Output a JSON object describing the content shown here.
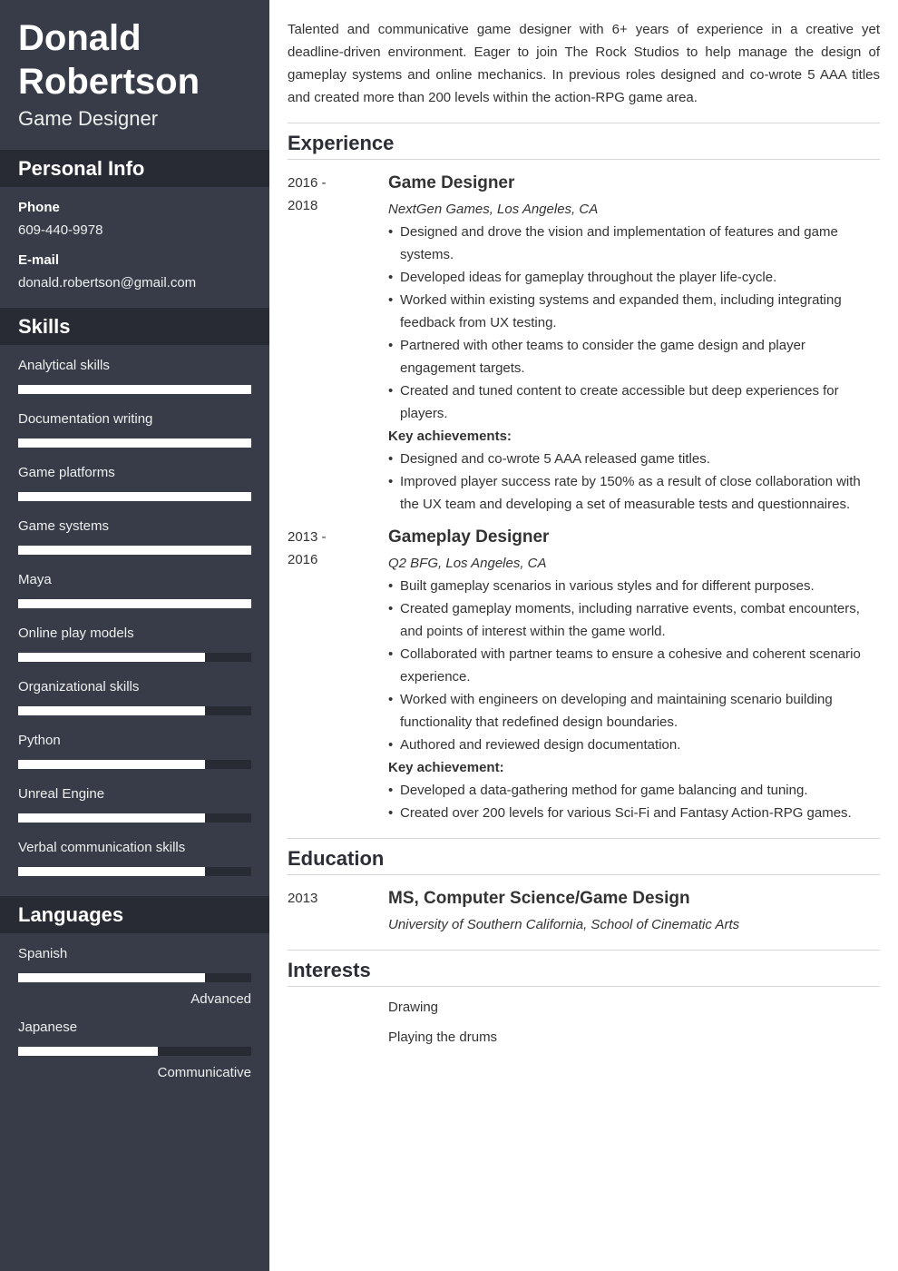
{
  "header": {
    "name_line1": "Donald",
    "name_line2": "Robertson",
    "title": "Game Designer"
  },
  "personal_info": {
    "heading": "Personal Info",
    "phone_label": "Phone",
    "phone": "609-440-9978",
    "email_label": "E-mail",
    "email": "donald.robertson@gmail.com"
  },
  "skills": {
    "heading": "Skills",
    "items": [
      {
        "label": "Analytical skills",
        "level": 1.0
      },
      {
        "label": "Documentation writing",
        "level": 1.0
      },
      {
        "label": "Game platforms",
        "level": 1.0
      },
      {
        "label": "Game systems",
        "level": 1.0
      },
      {
        "label": "Maya",
        "level": 1.0
      },
      {
        "label": "Online play models",
        "level": 0.8
      },
      {
        "label": "Organizational skills",
        "level": 0.8
      },
      {
        "label": "Python",
        "level": 0.8
      },
      {
        "label": "Unreal Engine",
        "level": 0.8
      },
      {
        "label": "Verbal communication skills",
        "level": 0.8
      }
    ]
  },
  "languages": {
    "heading": "Languages",
    "items": [
      {
        "label": "Spanish",
        "level": 0.8,
        "level_label": "Advanced"
      },
      {
        "label": "Japanese",
        "level": 0.6,
        "level_label": "Communicative"
      }
    ]
  },
  "summary": "Talented and communicative game designer with 6+ years of experience in a creative yet deadline-driven environment. Eager to join The Rock Studios to help manage the design of gameplay systems and online mechanics. In previous roles designed and co-wrote 5 AAA titles and created more than 200 levels within the action-RPG game area.",
  "experience": {
    "heading": "Experience",
    "entries": [
      {
        "date_start": "2016 -",
        "date_end": "2018",
        "title": "Game Designer",
        "company": "NextGen Games, Los Angeles, CA",
        "bullets": [
          "Designed and drove the vision and implementation of features and game systems.",
          "Developed ideas for gameplay throughout the player life-cycle.",
          "Worked within existing systems and expanded them, including integrating feedback from UX testing.",
          "Partnered with other teams to consider the game design and player engagement targets.",
          "Created and tuned content to create accessible but deep experiences for players."
        ],
        "achievements_label": "Key achievements:",
        "achievements": [
          "Designed and co-wrote 5 AAA released game titles.",
          "Improved player success rate by 150% as a result of close collaboration with the UX team and developing a set of measurable tests and questionnaires."
        ]
      },
      {
        "date_start": "2013 -",
        "date_end": "2016",
        "title": "Gameplay Designer",
        "company": "Q2 BFG, Los Angeles, CA",
        "bullets": [
          "Built gameplay scenarios in various styles and for different purposes.",
          "Created gameplay moments, including narrative events, combat encounters, and points of interest within the game world.",
          "Collaborated with partner teams to ensure a cohesive and coherent scenario experience.",
          "Worked with engineers on developing and maintaining scenario building functionality that redefined design boundaries.",
          "Authored and reviewed design documentation."
        ],
        "achievements_label": "Key achievement:",
        "achievements": [
          "Developed a data-gathering method for game balancing and tuning.",
          "Created over 200 levels for various Sci-Fi and Fantasy Action-RPG games."
        ]
      }
    ]
  },
  "education": {
    "heading": "Education",
    "entries": [
      {
        "date": "2013",
        "degree": "MS, Computer Science/Game Design",
        "school": "University of Southern California, School of Cinematic Arts"
      }
    ]
  },
  "interests": {
    "heading": "Interests",
    "items": [
      "Drawing",
      "Playing the drums"
    ]
  }
}
